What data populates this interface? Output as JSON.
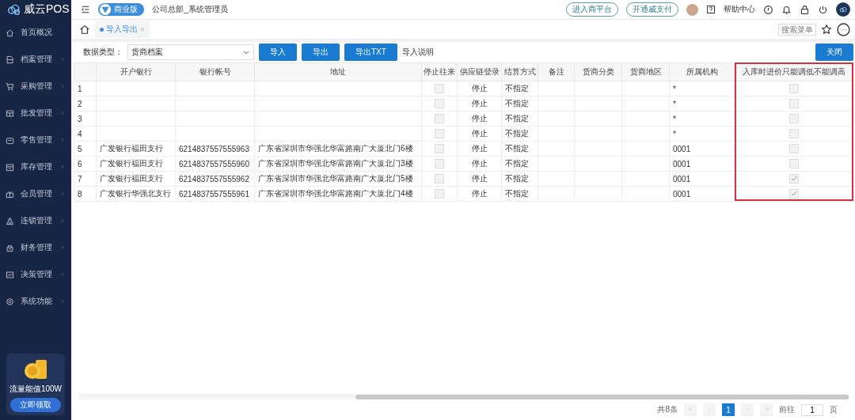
{
  "brand": {
    "name": "威云POS"
  },
  "sidebar": {
    "items": [
      {
        "label": "首页概况",
        "expandable": false
      },
      {
        "label": "档案管理",
        "expandable": true
      },
      {
        "label": "采购管理",
        "expandable": true
      },
      {
        "label": "批发管理",
        "expandable": true
      },
      {
        "label": "零售管理",
        "expandable": true
      },
      {
        "label": "库存管理",
        "expandable": true
      },
      {
        "label": "会员管理",
        "expandable": true
      },
      {
        "label": "连锁管理",
        "expandable": true
      },
      {
        "label": "财务管理",
        "expandable": true
      },
      {
        "label": "决策管理",
        "expandable": true
      },
      {
        "label": "系统功能",
        "expandable": true
      }
    ],
    "promo": {
      "text": "流量能值100W",
      "button": "立即领取"
    }
  },
  "topbar": {
    "edition": "商业版",
    "user": "公司总部_系统管理员",
    "links": [
      "进入商平台",
      "开通威支付"
    ],
    "help": "帮助中心"
  },
  "tabs": [
    {
      "label": "导入导出",
      "selected": true,
      "close": "×"
    }
  ],
  "menu_search": {
    "placeholder": "搜索菜单"
  },
  "toolbar": {
    "label": "数据类型：",
    "select": "货商档案",
    "buttons": [
      "导入",
      "导出",
      "导出TXT"
    ],
    "link": "导入说明",
    "close": "关闭"
  },
  "table": {
    "columns": [
      "开户银行",
      "银行帐号",
      "地址",
      "停止往来",
      "供应链登录",
      "结算方式",
      "备注",
      "货商分类",
      "货商地区",
      "所属机构",
      "入库时进价只能调低不能调高"
    ],
    "rows": [
      {
        "index": "1",
        "bank": "",
        "account": "",
        "address": "",
        "stopped": false,
        "supply_login": "停止",
        "settlement": "不指定",
        "org": "*",
        "price_lower_only": false
      },
      {
        "index": "2",
        "bank": "",
        "account": "",
        "address": "",
        "stopped": false,
        "supply_login": "停止",
        "settlement": "不指定",
        "org": "*",
        "price_lower_only": false
      },
      {
        "index": "3",
        "bank": "",
        "account": "",
        "address": "",
        "stopped": false,
        "supply_login": "停止",
        "settlement": "不指定",
        "org": "*",
        "price_lower_only": false
      },
      {
        "index": "4",
        "bank": "",
        "account": "",
        "address": "",
        "stopped": false,
        "supply_login": "停止",
        "settlement": "不指定",
        "org": "*",
        "price_lower_only": false
      },
      {
        "index": "5",
        "bank": "广发银行福田支行",
        "account": "6214837557555963",
        "address": "广东省深圳市华强北华富路南广大厦北门6楼",
        "stopped": false,
        "supply_login": "停止",
        "settlement": "不指定",
        "org": "0001",
        "price_lower_only": false
      },
      {
        "index": "6",
        "bank": "广发银行福田支行",
        "account": "6214837557555960",
        "address": "广东省深圳市华强北华富路南广大厦北门3楼",
        "stopped": false,
        "supply_login": "停止",
        "settlement": "不指定",
        "org": "0001",
        "price_lower_only": false
      },
      {
        "index": "7",
        "bank": "广发银行福田支行",
        "account": "6214837557555962",
        "address": "广东省深圳市华强北华富路南广大厦北门5楼",
        "stopped": false,
        "supply_login": "停止",
        "settlement": "不指定",
        "org": "0001",
        "price_lower_only": true
      },
      {
        "index": "8",
        "bank": "广发银行华强北支行",
        "account": "6214837557555961",
        "address": "广东省深圳市华强北华富路南广大厦北门4楼",
        "stopped": false,
        "supply_login": "停止",
        "settlement": "不指定",
        "org": "0001",
        "price_lower_only": true
      }
    ]
  },
  "pagination": {
    "total": "共8条",
    "pages": [
      {
        "label": "1",
        "selected": true
      }
    ],
    "goto": "前往",
    "page_input": "1",
    "page_suffix": "页"
  }
}
